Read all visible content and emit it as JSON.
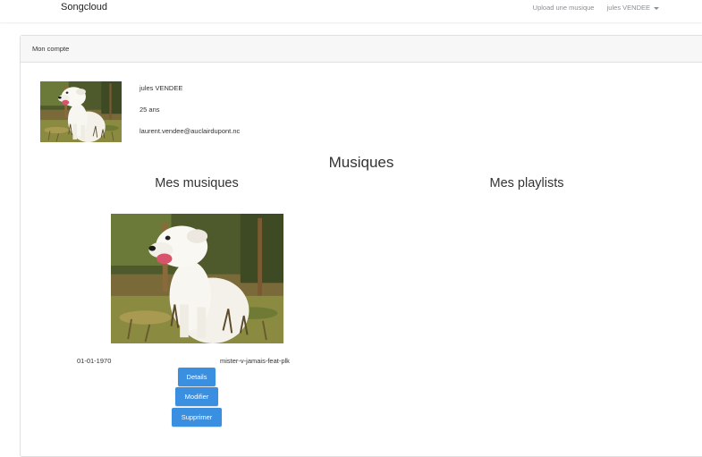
{
  "navbar": {
    "brand": "Songcloud",
    "upload_link": "Upload une musique",
    "user_menu": "jules VENDEE"
  },
  "account": {
    "header": "Mon compte",
    "name": "jules VENDEE",
    "age": "25 ans",
    "email": "laurent.vendee@auclairdupont.nc"
  },
  "sections": {
    "title": "Musiques",
    "my_music": "Mes musiques",
    "my_playlists": "Mes playlists"
  },
  "tracks": [
    {
      "date": "01-01-1970",
      "name": "mister-v-jamais-feat-plk",
      "actions": {
        "details": "Details",
        "edit": "Modifier",
        "delete": "Supprimer"
      }
    }
  ],
  "colors": {
    "primary_button": "#3b8fe0",
    "card_header_bg": "#f7f7f7"
  }
}
